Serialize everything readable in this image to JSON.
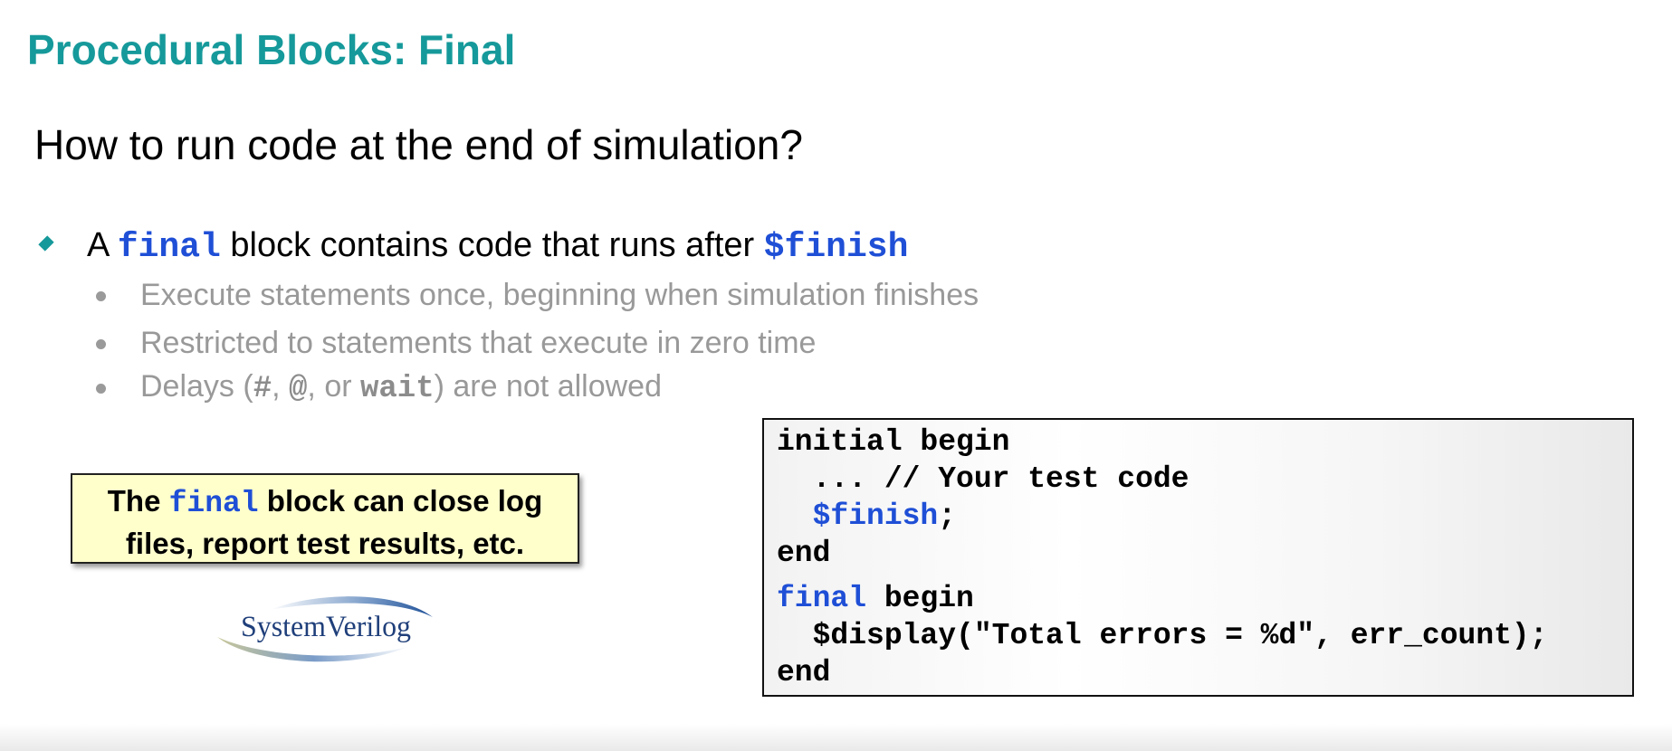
{
  "slide": {
    "title": "Procedural Blocks: Final",
    "subtitle": "How to run code at the end of simulation?"
  },
  "main_bullet": {
    "prefix": "A ",
    "keyword": "final",
    "middle": " block contains code that runs after ",
    "keyword2": "$finish"
  },
  "sub_bullets": [
    "Execute statements once, beginning when simulation finishes",
    "Restricted to statements that execute in zero time"
  ],
  "delays_bullet": {
    "prefix": "Delays (",
    "hash": "#",
    "comma1": ", ",
    "at": "@",
    "comma2": ", or ",
    "wait": "wait",
    "suffix": ") are not allowed"
  },
  "callout": {
    "prefix": "The ",
    "keyword": "final",
    "line1_rest": " block can close log",
    "line2": "files, report test results, etc."
  },
  "logo": {
    "text": "SystemVerilog"
  },
  "code": {
    "l1": "initial begin",
    "l2": "  ... // Your test code",
    "l3_indent": "  ",
    "l3_kw": "$finish",
    "l3_rest": ";",
    "l4": "end",
    "l5_kw": "final",
    "l5_rest": " begin",
    "l6": "  $display(\"Total errors = %d\", err_count);",
    "l7": "end"
  },
  "colors": {
    "title": "#16999a",
    "keyword": "#1f4fd6",
    "callout_bg": "#ffffcc",
    "sub_text": "#999999"
  }
}
